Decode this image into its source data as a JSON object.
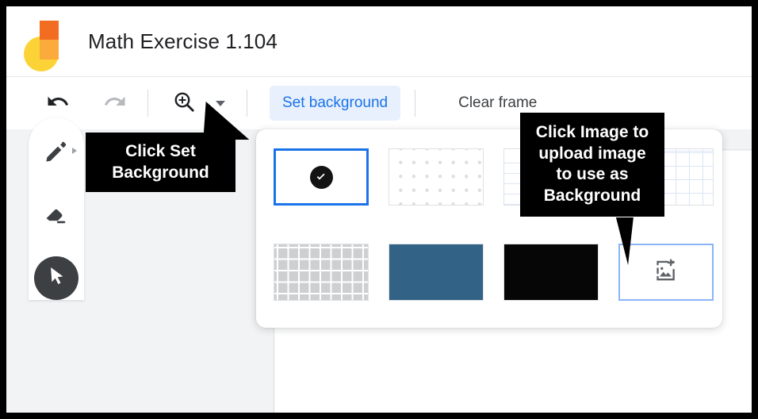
{
  "app": {
    "logo_icon": "jamboard-logo",
    "title": "Math Exercise 1.104"
  },
  "toolbar": {
    "undo_icon": "undo-arrow-icon",
    "redo_icon": "redo-arrow-icon",
    "zoom_icon": "zoom-in-magnifier-icon",
    "zoom_caret_icon": "chevron-down-icon",
    "set_background_label": "Set background",
    "clear_frame_label": "Clear frame",
    "accent_color": "#1a73e8",
    "active_button_bg": "#e8f0fe"
  },
  "tools": [
    {
      "name": "pen-tool",
      "icon": "pen-icon",
      "selected": false,
      "has_expander": true
    },
    {
      "name": "eraser-tool",
      "icon": "eraser-icon",
      "selected": false,
      "has_expander": false
    },
    {
      "name": "select-tool",
      "icon": "cursor-arrow-icon",
      "selected": true,
      "has_expander": false
    }
  ],
  "background_panel": {
    "rows": [
      [
        {
          "name": "background-white",
          "style": "solid-white",
          "selected": true,
          "check_icon": "check-circle-icon"
        },
        {
          "name": "background-dots",
          "style": "dotted-pattern",
          "selected": false
        },
        {
          "name": "background-lines",
          "style": "ruled-lines-pattern",
          "selected": false
        },
        {
          "name": "background-grid-blue",
          "style": "blue-grid-pattern",
          "selected": false
        }
      ],
      [
        {
          "name": "background-grid-gray",
          "style": "gray-grid-pattern",
          "selected": false
        },
        {
          "name": "background-blue",
          "style": "solid-blue",
          "color": "#326285",
          "selected": false
        },
        {
          "name": "background-black",
          "style": "solid-black",
          "color": "#060606",
          "selected": false
        },
        {
          "name": "background-upload-image",
          "style": "image-upload",
          "icon": "add-photo-icon",
          "selected": false
        }
      ]
    ],
    "selected_border_color": "#1a73e8",
    "upload_border_color": "#8ab4f8"
  },
  "callouts": [
    {
      "name": "callout-set-background",
      "lines": [
        "Click Set",
        "Background"
      ],
      "text": "Click Set Background",
      "background": "#000000",
      "text_color": "#ffffff",
      "points_to": "set-background-button"
    },
    {
      "name": "callout-upload-image",
      "lines": [
        "Click Image to",
        "upload image",
        "to use as",
        "Background"
      ],
      "text": "Click Image to upload image to use as Background",
      "background": "#000000",
      "text_color": "#ffffff",
      "points_to": "background-upload-image"
    }
  ]
}
